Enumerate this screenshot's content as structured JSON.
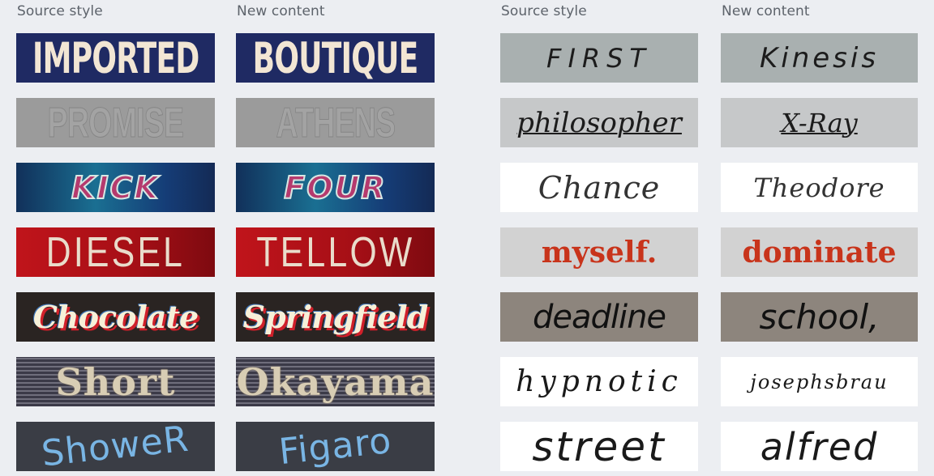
{
  "headers": {
    "left_source": "Source style",
    "left_new": "New content",
    "right_source": "Source style",
    "right_new": "New content"
  },
  "left_pairs": [
    {
      "source": "IMPORTED",
      "new": "BOUTIQUE",
      "style": "navy sign, cream condensed bold"
    },
    {
      "source": "PROMISE",
      "new": "ATHENS",
      "style": "gray embossed outline"
    },
    {
      "source": "KICK",
      "new": "FOUR",
      "style": "magenta italic on blue, white outline"
    },
    {
      "source": "DIESEL",
      "new": "TELLOW",
      "style": "cream letters on red"
    },
    {
      "source": "Chocolate",
      "new": "Springfield",
      "style": "cream script with red shadow on dark"
    },
    {
      "source": "Short",
      "new": "Okayama",
      "style": "serif on woven fabric texture"
    },
    {
      "source": "ShoweR",
      "new": "Figaro",
      "style": "blue chalk on chalkboard"
    }
  ],
  "right_pairs": [
    {
      "source": "FIRST",
      "new": "Kinesis",
      "style": "handwriting on gray paper"
    },
    {
      "source": "philosopher",
      "new": "X-Ray",
      "style": "underlined handwriting on light gray"
    },
    {
      "source": "Chance",
      "new": "Theodore",
      "style": "handwriting on white"
    },
    {
      "source": "myself.",
      "new": "dominate",
      "style": "red-orange blackletter calligraphy"
    },
    {
      "source": "deadline",
      "new": "school,",
      "style": "marker on taupe"
    },
    {
      "source": "hypnotic",
      "new": "josephsbrau",
      "style": "slanted handwriting on white"
    },
    {
      "source": "street",
      "new": "alfred",
      "style": "bold handwriting on white"
    }
  ]
}
